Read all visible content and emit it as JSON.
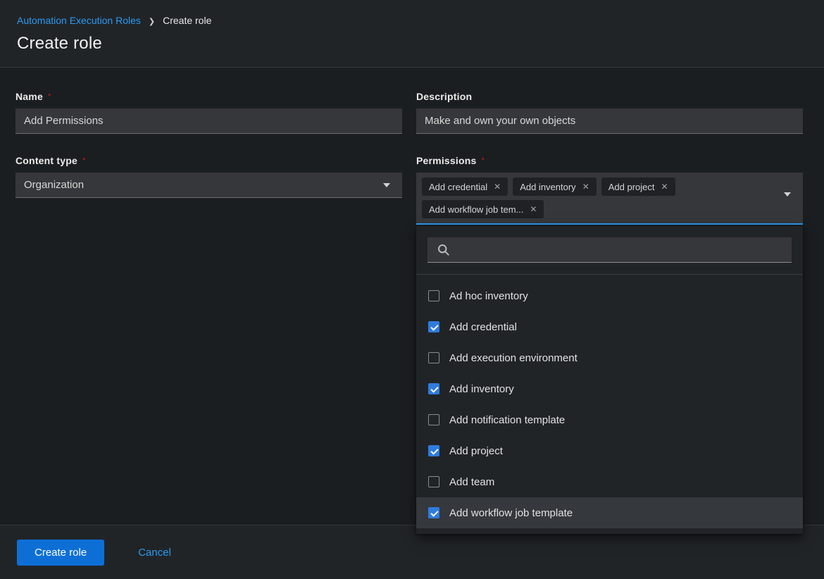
{
  "breadcrumb": {
    "parent": "Automation Execution Roles",
    "current": "Create role"
  },
  "header": {
    "title": "Create role"
  },
  "form": {
    "name": {
      "label": "Name",
      "required_marker": "*",
      "value": "Add Permissions"
    },
    "description": {
      "label": "Description",
      "value": "Make and own your own objects"
    },
    "content_type": {
      "label": "Content type",
      "required_marker": "*",
      "value": "Organization"
    },
    "permissions": {
      "label": "Permissions",
      "required_marker": "*",
      "selected_chips": [
        "Add credential",
        "Add inventory",
        "Add project",
        "Add workflow job tem..."
      ],
      "search": {
        "value": "",
        "placeholder": ""
      },
      "options": [
        {
          "label": "Ad hoc inventory",
          "checked": false,
          "highlighted": false
        },
        {
          "label": "Add credential",
          "checked": true,
          "highlighted": false
        },
        {
          "label": "Add execution environment",
          "checked": false,
          "highlighted": false
        },
        {
          "label": "Add inventory",
          "checked": true,
          "highlighted": false
        },
        {
          "label": "Add notification template",
          "checked": false,
          "highlighted": false
        },
        {
          "label": "Add project",
          "checked": true,
          "highlighted": false
        },
        {
          "label": "Add team",
          "checked": false,
          "highlighted": false
        },
        {
          "label": "Add workflow job template",
          "checked": true,
          "highlighted": true
        }
      ]
    }
  },
  "footer": {
    "submit": "Create role",
    "cancel": "Cancel"
  },
  "icons": {
    "breadcrumb_separator": "❯",
    "chip_close": "✕",
    "caret_down": "caret-down-triangle",
    "search": "magnifier"
  },
  "colors": {
    "accent_link": "#2b9af3",
    "primary_button": "#0d6fd6",
    "checkbox_checked": "#2e7ce0",
    "required_asterisk": "#c9190b",
    "focus_border": "#2b9af3",
    "header_bg": "#212427",
    "content_bg": "#1b1e21",
    "input_bg": "#36373a"
  }
}
